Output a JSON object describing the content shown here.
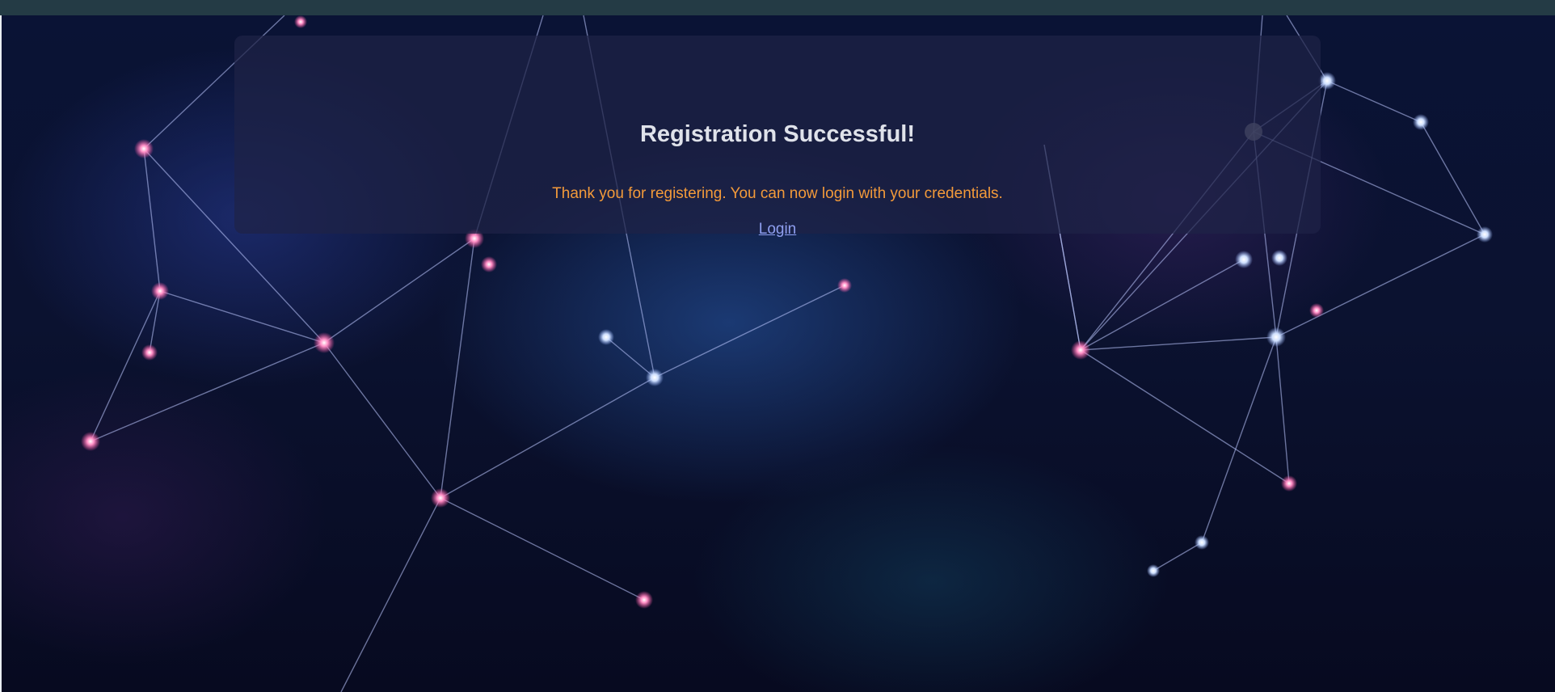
{
  "card": {
    "title": "Registration Successful!",
    "message": "Thank you for registering. You can now login with your credentials.",
    "login_link": "Login"
  },
  "colors": {
    "top_bar": "#243b45",
    "title_text": "#dfe2ea",
    "message_text": "#f39a3a",
    "link_text": "#8f9ff0",
    "card_background": "rgba(30, 34, 70, 0.72)"
  }
}
